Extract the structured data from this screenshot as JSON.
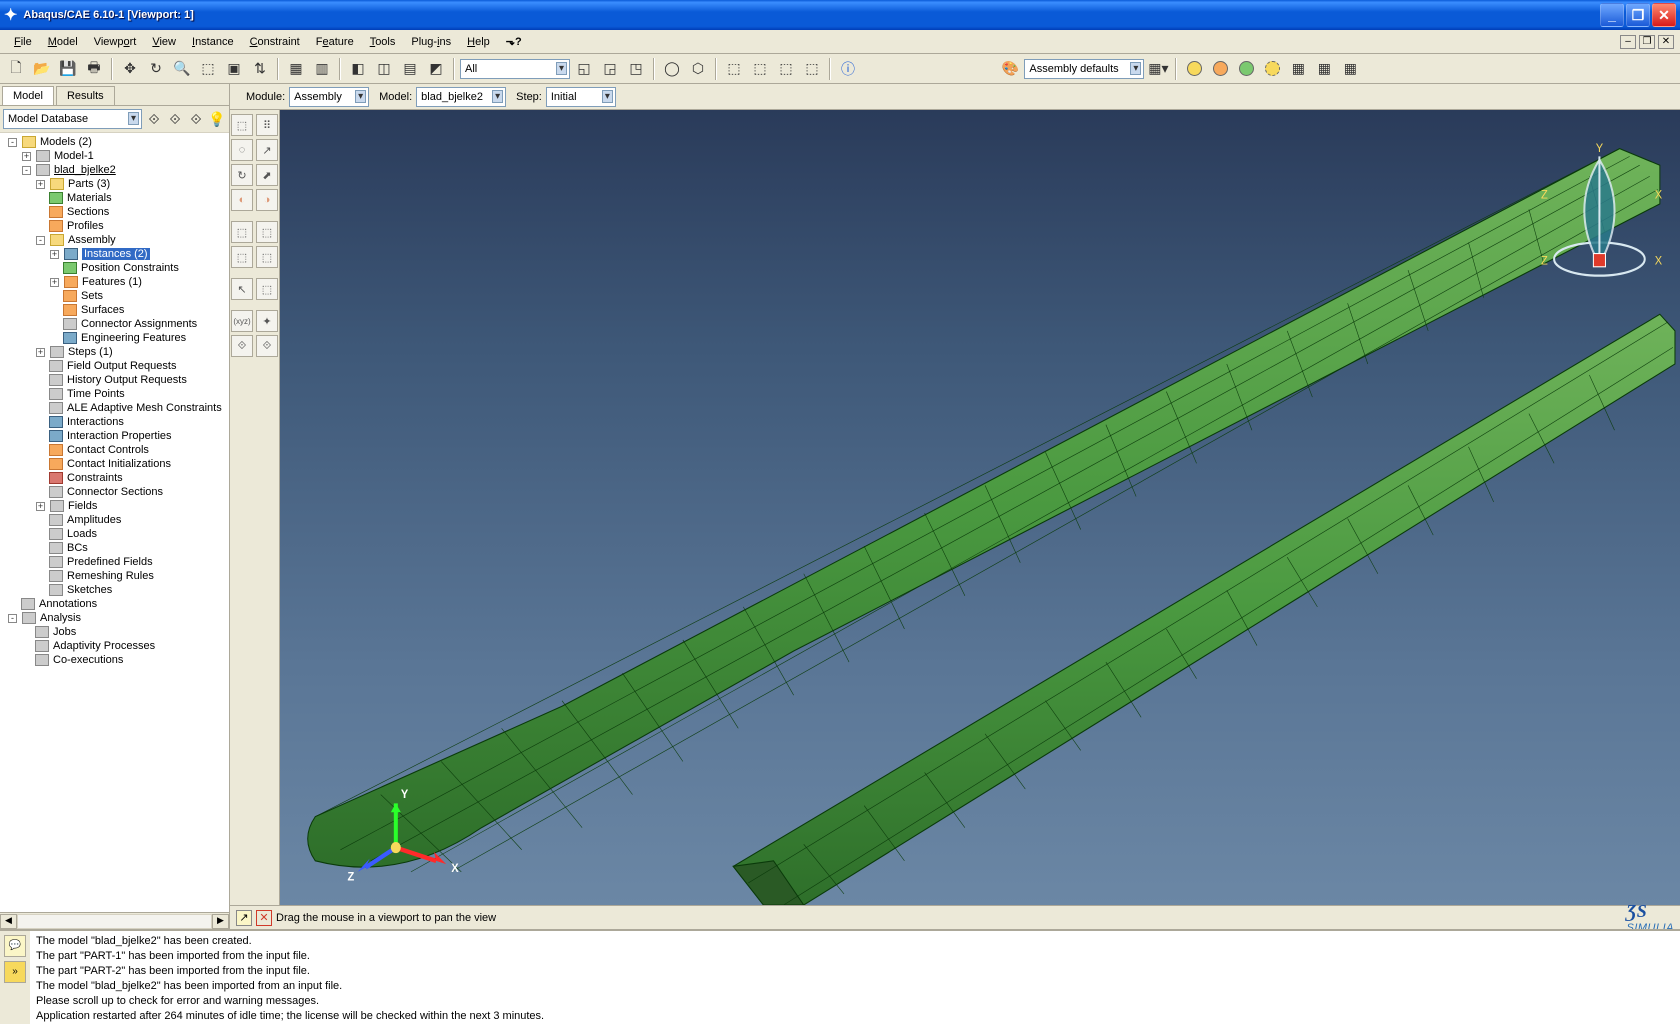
{
  "window": {
    "title": "Abaqus/CAE 6.10-1 [Viewport: 1]"
  },
  "menu": [
    "File",
    "Model",
    "Viewport",
    "View",
    "Instance",
    "Constraint",
    "Feature",
    "Tools",
    "Plug-ins",
    "Help"
  ],
  "toolbar2": {
    "combo1": "All",
    "combo2": "Assembly defaults"
  },
  "context": {
    "module_label": "Module:",
    "module": "Assembly",
    "model_label": "Model:",
    "model": "blad_bjelke2",
    "step_label": "Step:",
    "step": "Initial"
  },
  "tabs": {
    "t1": "Model",
    "t2": "Results"
  },
  "treectl": {
    "combo": "Model Database"
  },
  "tree": {
    "root": "Models (2)",
    "m1": "Model-1",
    "m2": "blad_bjelke2",
    "parts": "Parts (3)",
    "materials": "Materials",
    "sections": "Sections",
    "profiles": "Profiles",
    "assembly": "Assembly",
    "instances": "Instances (2)",
    "posc": "Position Constraints",
    "features": "Features (1)",
    "sets": "Sets",
    "surfaces": "Surfaces",
    "connass": "Connector Assignments",
    "engfeat": "Engineering Features",
    "steps": "Steps (1)",
    "for": "Field Output Requests",
    "hor": "History Output Requests",
    "tp": "Time Points",
    "ale": "ALE Adaptive Mesh Constraints",
    "inter": "Interactions",
    "interp": "Interaction Properties",
    "cc": "Contact Controls",
    "ci": "Contact Initializations",
    "constr": "Constraints",
    "cs": "Connector Sections",
    "fields": "Fields",
    "amp": "Amplitudes",
    "loads": "Loads",
    "bcs": "BCs",
    "predef": "Predefined Fields",
    "remesh": "Remeshing Rules",
    "sketches": "Sketches",
    "annot": "Annotations",
    "analysis": "Analysis",
    "jobs": "Jobs",
    "adapt": "Adaptivity Processes",
    "coexec": "Co-executions"
  },
  "status": {
    "text": "Drag the mouse in a viewport to pan the view"
  },
  "simulia": "SIMULIA",
  "triad": {
    "x": "X",
    "y": "Y",
    "z": "Z"
  },
  "compass": {
    "x": "X",
    "y": "Y",
    "z": "Z"
  },
  "console": [
    "The model \"blad_bjelke2\" has been created.",
    "The part \"PART-1\" has been imported from the input file.",
    "The part \"PART-2\" has been imported from the input file.",
    "The model \"blad_bjelke2\" has been imported from an input file.",
    "Please scroll up to check for error and warning messages.",
    "Application restarted after 264 minutes of idle time; the license will be checked within the next 3 minutes."
  ]
}
